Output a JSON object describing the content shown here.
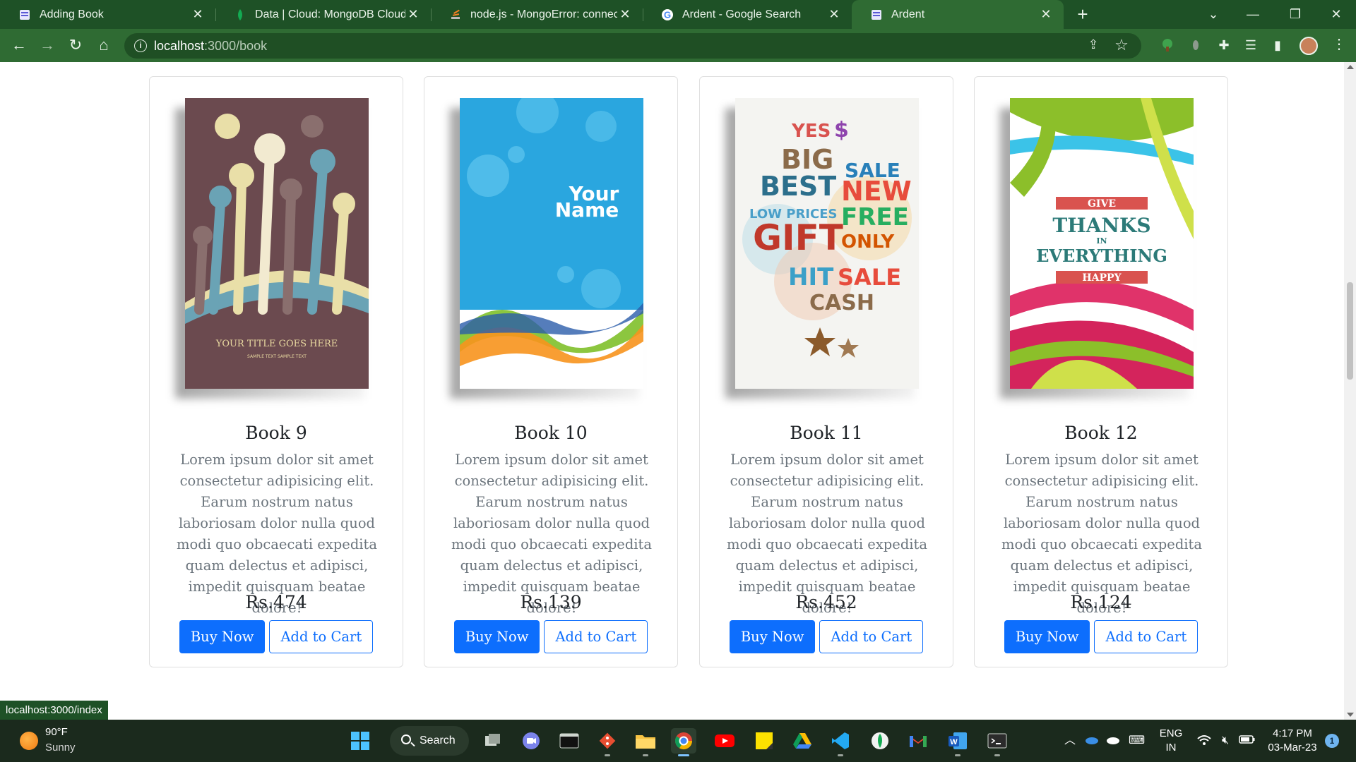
{
  "browser": {
    "tabs": [
      {
        "title": "Adding Book",
        "favicon": "book-favicon",
        "active": false
      },
      {
        "title": "Data | Cloud: MongoDB Cloud",
        "favicon": "mongodb-leaf-favicon",
        "active": false
      },
      {
        "title": "node.js - MongoError: connect EC",
        "favicon": "stackoverflow-favicon",
        "active": false
      },
      {
        "title": "Ardent - Google Search",
        "favicon": "google-favicon",
        "active": false
      },
      {
        "title": "Ardent",
        "favicon": "book-favicon",
        "active": true
      }
    ],
    "address": {
      "host": "localhost",
      "path": ":3000/book"
    },
    "status_url": "localhost:3000/index"
  },
  "books": [
    {
      "title": "Book 9",
      "description": "Lorem ipsum dolor sit amet consectetur adipisicing elit. Earum nostrum natus laboriosam dolor nulla quod modi quo obcaecati expedita quam delectus et adipisci, impedit quisquam beatae dolore!",
      "price": "Rs.474",
      "buy_label": "Buy Now",
      "cart_label": "Add to Cart",
      "cover": {
        "style": "hands",
        "line1": "YOUR TITLE GOES HERE",
        "line2": "SAMPLE TEXT SAMPLE TEXT"
      }
    },
    {
      "title": "Book 10",
      "description": "Lorem ipsum dolor sit amet consectetur adipisicing elit. Earum nostrum natus laboriosam dolor nulla quod modi quo obcaecati expedita quam delectus et adipisci, impedit quisquam beatae dolore!",
      "price": "Rs.139",
      "buy_label": "Buy Now",
      "cart_label": "Add to Cart",
      "cover": {
        "style": "waves",
        "line1": "Your",
        "line2": "Name"
      }
    },
    {
      "title": "Book 11",
      "description": "Lorem ipsum dolor sit amet consectetur adipisicing elit. Earum nostrum natus laboriosam dolor nulla quod modi quo obcaecati expedita quam delectus et adipisci, impedit quisquam beatae dolore!",
      "price": "Rs.452",
      "buy_label": "Buy Now",
      "cart_label": "Add to Cart",
      "cover": {
        "style": "sale",
        "words": [
          "YES",
          "$",
          "BIG",
          "SALE",
          "BEST",
          "NEW",
          "LOW PRICES",
          "FREE",
          "GIFT",
          "ONLY",
          "HIT",
          "SALE",
          "CASH"
        ]
      }
    },
    {
      "title": "Book 12",
      "description": "Lorem ipsum dolor sit amet consectetur adipisicing elit. Earum nostrum natus laboriosam dolor nulla quod modi quo obcaecati expedita quam delectus et adipisci, impedit quisquam beatae dolore!",
      "price": "Rs.124",
      "buy_label": "Buy Now",
      "cart_label": "Add to Cart",
      "cover": {
        "style": "thanks",
        "words": [
          "GIVE",
          "THANKS",
          "IN",
          "EVERYTHING",
          "HAPPY"
        ]
      }
    }
  ],
  "taskbar": {
    "weather_temp": "90°F",
    "weather_cond": "Sunny",
    "search_label": "Search",
    "lang_line1": "ENG",
    "lang_line2": "IN",
    "time": "4:17 PM",
    "date": "03-Mar-23",
    "notification_count": "1"
  },
  "colors": {
    "tab_strip": "#1e5126",
    "toolbar": "#2f6b33",
    "primary_button": "#0d6efd"
  }
}
